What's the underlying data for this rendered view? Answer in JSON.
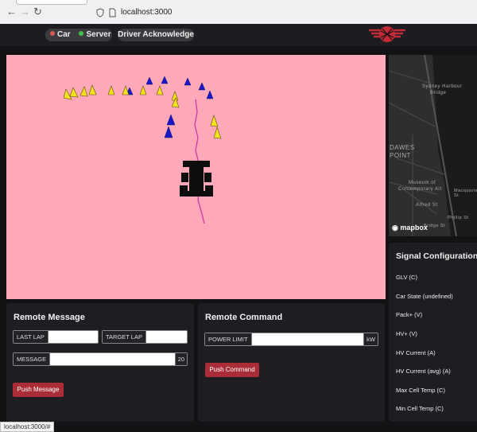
{
  "browser": {
    "url": "localhost:3000"
  },
  "header": {
    "car_label": "Car",
    "server_label": "Server",
    "driver_ack_label": "Driver Acknowledge",
    "car_status_color": "#e05555",
    "server_status_color": "#3cc04e"
  },
  "map": {
    "labels": [
      "Sydney Harbour",
      "Bridge",
      "DAWES",
      "POINT",
      "Museum of",
      "Contemporary Art",
      "Alfred St",
      "Macquarie St",
      "Bridge St",
      "Phillip St"
    ],
    "attribution": "mapbox"
  },
  "remote_message": {
    "title": "Remote Message",
    "last_lap_label": "LAST LAP",
    "last_lap_value": "",
    "target_lap_label": "TARGET LAP",
    "target_lap_value": "",
    "message_label": "MESSAGE",
    "message_value": "",
    "message_count": "20",
    "push_button": "Push Message"
  },
  "remote_command": {
    "title": "Remote Command",
    "power_limit_label": "POWER LIMIT",
    "power_limit_value": "",
    "power_limit_unit": "kW",
    "push_button": "Push Command"
  },
  "signals": {
    "title": "Signal Configuration (C",
    "items": [
      "GLV (C)",
      "Car State (undefined)",
      "Pack+ (V)",
      "HV+ (V)",
      "HV Current (A)",
      "HV Current (avg) (A)",
      "Max Cell Temp (C)",
      "Min Cell Temp (C)"
    ]
  },
  "status_bar": {
    "link": "localhost:3000/#"
  }
}
